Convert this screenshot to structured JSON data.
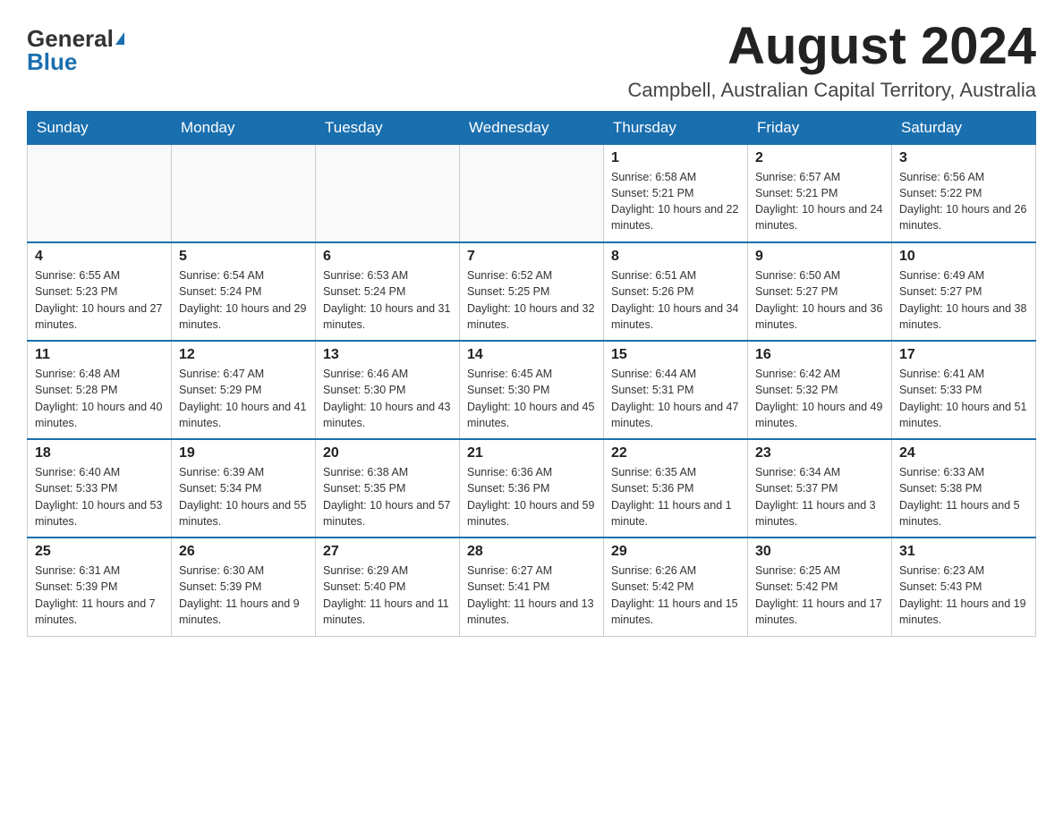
{
  "header": {
    "logo_general": "General",
    "logo_blue": "Blue",
    "month_year": "August 2024",
    "location": "Campbell, Australian Capital Territory, Australia"
  },
  "weekdays": [
    "Sunday",
    "Monday",
    "Tuesday",
    "Wednesday",
    "Thursday",
    "Friday",
    "Saturday"
  ],
  "weeks": [
    [
      {
        "day": "",
        "info": ""
      },
      {
        "day": "",
        "info": ""
      },
      {
        "day": "",
        "info": ""
      },
      {
        "day": "",
        "info": ""
      },
      {
        "day": "1",
        "info": "Sunrise: 6:58 AM\nSunset: 5:21 PM\nDaylight: 10 hours and 22 minutes."
      },
      {
        "day": "2",
        "info": "Sunrise: 6:57 AM\nSunset: 5:21 PM\nDaylight: 10 hours and 24 minutes."
      },
      {
        "day": "3",
        "info": "Sunrise: 6:56 AM\nSunset: 5:22 PM\nDaylight: 10 hours and 26 minutes."
      }
    ],
    [
      {
        "day": "4",
        "info": "Sunrise: 6:55 AM\nSunset: 5:23 PM\nDaylight: 10 hours and 27 minutes."
      },
      {
        "day": "5",
        "info": "Sunrise: 6:54 AM\nSunset: 5:24 PM\nDaylight: 10 hours and 29 minutes."
      },
      {
        "day": "6",
        "info": "Sunrise: 6:53 AM\nSunset: 5:24 PM\nDaylight: 10 hours and 31 minutes."
      },
      {
        "day": "7",
        "info": "Sunrise: 6:52 AM\nSunset: 5:25 PM\nDaylight: 10 hours and 32 minutes."
      },
      {
        "day": "8",
        "info": "Sunrise: 6:51 AM\nSunset: 5:26 PM\nDaylight: 10 hours and 34 minutes."
      },
      {
        "day": "9",
        "info": "Sunrise: 6:50 AM\nSunset: 5:27 PM\nDaylight: 10 hours and 36 minutes."
      },
      {
        "day": "10",
        "info": "Sunrise: 6:49 AM\nSunset: 5:27 PM\nDaylight: 10 hours and 38 minutes."
      }
    ],
    [
      {
        "day": "11",
        "info": "Sunrise: 6:48 AM\nSunset: 5:28 PM\nDaylight: 10 hours and 40 minutes."
      },
      {
        "day": "12",
        "info": "Sunrise: 6:47 AM\nSunset: 5:29 PM\nDaylight: 10 hours and 41 minutes."
      },
      {
        "day": "13",
        "info": "Sunrise: 6:46 AM\nSunset: 5:30 PM\nDaylight: 10 hours and 43 minutes."
      },
      {
        "day": "14",
        "info": "Sunrise: 6:45 AM\nSunset: 5:30 PM\nDaylight: 10 hours and 45 minutes."
      },
      {
        "day": "15",
        "info": "Sunrise: 6:44 AM\nSunset: 5:31 PM\nDaylight: 10 hours and 47 minutes."
      },
      {
        "day": "16",
        "info": "Sunrise: 6:42 AM\nSunset: 5:32 PM\nDaylight: 10 hours and 49 minutes."
      },
      {
        "day": "17",
        "info": "Sunrise: 6:41 AM\nSunset: 5:33 PM\nDaylight: 10 hours and 51 minutes."
      }
    ],
    [
      {
        "day": "18",
        "info": "Sunrise: 6:40 AM\nSunset: 5:33 PM\nDaylight: 10 hours and 53 minutes."
      },
      {
        "day": "19",
        "info": "Sunrise: 6:39 AM\nSunset: 5:34 PM\nDaylight: 10 hours and 55 minutes."
      },
      {
        "day": "20",
        "info": "Sunrise: 6:38 AM\nSunset: 5:35 PM\nDaylight: 10 hours and 57 minutes."
      },
      {
        "day": "21",
        "info": "Sunrise: 6:36 AM\nSunset: 5:36 PM\nDaylight: 10 hours and 59 minutes."
      },
      {
        "day": "22",
        "info": "Sunrise: 6:35 AM\nSunset: 5:36 PM\nDaylight: 11 hours and 1 minute."
      },
      {
        "day": "23",
        "info": "Sunrise: 6:34 AM\nSunset: 5:37 PM\nDaylight: 11 hours and 3 minutes."
      },
      {
        "day": "24",
        "info": "Sunrise: 6:33 AM\nSunset: 5:38 PM\nDaylight: 11 hours and 5 minutes."
      }
    ],
    [
      {
        "day": "25",
        "info": "Sunrise: 6:31 AM\nSunset: 5:39 PM\nDaylight: 11 hours and 7 minutes."
      },
      {
        "day": "26",
        "info": "Sunrise: 6:30 AM\nSunset: 5:39 PM\nDaylight: 11 hours and 9 minutes."
      },
      {
        "day": "27",
        "info": "Sunrise: 6:29 AM\nSunset: 5:40 PM\nDaylight: 11 hours and 11 minutes."
      },
      {
        "day": "28",
        "info": "Sunrise: 6:27 AM\nSunset: 5:41 PM\nDaylight: 11 hours and 13 minutes."
      },
      {
        "day": "29",
        "info": "Sunrise: 6:26 AM\nSunset: 5:42 PM\nDaylight: 11 hours and 15 minutes."
      },
      {
        "day": "30",
        "info": "Sunrise: 6:25 AM\nSunset: 5:42 PM\nDaylight: 11 hours and 17 minutes."
      },
      {
        "day": "31",
        "info": "Sunrise: 6:23 AM\nSunset: 5:43 PM\nDaylight: 11 hours and 19 minutes."
      }
    ]
  ]
}
